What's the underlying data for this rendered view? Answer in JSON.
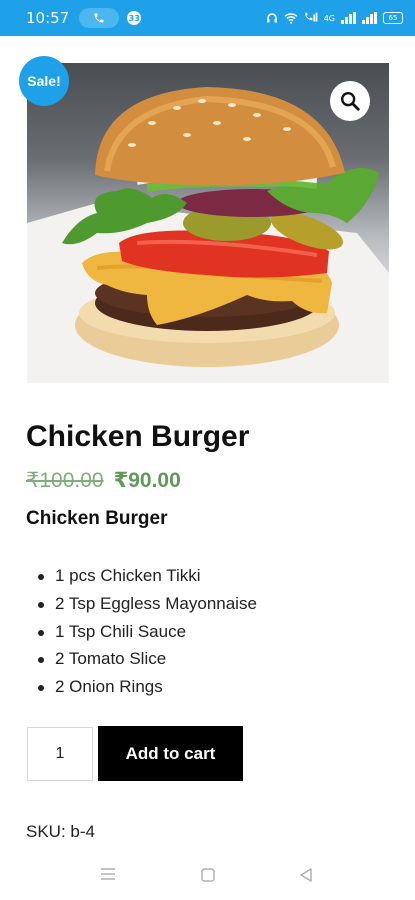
{
  "status_bar": {
    "time": "10:57",
    "notification_count": "33",
    "network_label": "4G",
    "battery": "65"
  },
  "product": {
    "sale_badge": "Sale!",
    "title": "Chicken Burger",
    "price_old": "₹100.00",
    "price_new": "₹90.00",
    "description_heading": "Chicken Burger",
    "ingredients": [
      "1 pcs Chicken Tikki",
      "2 Tsp Eggless Mayonnaise",
      "1 Tsp Chili Sauce",
      "2 Tomato Slice",
      "2 Onion Rings"
    ],
    "quantity": "1",
    "add_to_cart_label": "Add to cart",
    "sku": "SKU: b-4"
  },
  "icons": {
    "zoom": "magnifier-icon",
    "call": "phone-icon",
    "nav_menu": "menu-icon",
    "nav_home": "home-icon",
    "nav_back": "back-icon"
  },
  "colors": {
    "accent": "#1ea1e8",
    "price": "#5f9a58",
    "button": "#000000"
  }
}
